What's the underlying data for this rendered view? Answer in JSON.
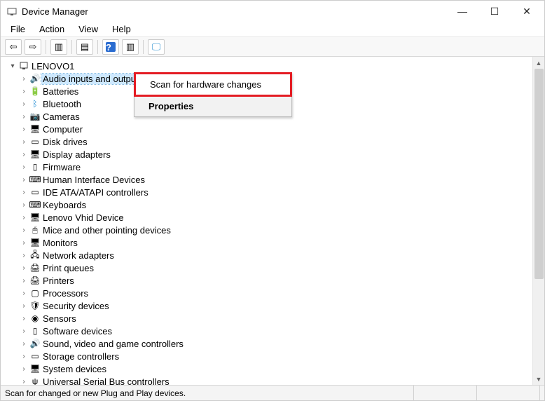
{
  "window": {
    "title": "Device Manager"
  },
  "menubar": {
    "items": [
      "File",
      "Action",
      "View",
      "Help"
    ]
  },
  "toolbar": {
    "back": "←",
    "forward": "→",
    "show_hide_console_tree": "▣",
    "properties": "▦",
    "help": "?",
    "refresh": "⟳",
    "scan": "🖵"
  },
  "tree": {
    "root_label": "LENOVO1",
    "categories": [
      {
        "label": "Audio inputs and outputs",
        "icon": "🔊",
        "selected": true
      },
      {
        "label": "Batteries",
        "icon": "🔋"
      },
      {
        "label": "Bluetooth",
        "icon": "ᛒ",
        "color": "#1084d0"
      },
      {
        "label": "Cameras",
        "icon": "📷"
      },
      {
        "label": "Computer",
        "icon": "🖥"
      },
      {
        "label": "Disk drives",
        "icon": "▭"
      },
      {
        "label": "Display adapters",
        "icon": "🖥"
      },
      {
        "label": "Firmware",
        "icon": "▯"
      },
      {
        "label": "Human Interface Devices",
        "icon": "⌨"
      },
      {
        "label": "IDE ATA/ATAPI controllers",
        "icon": "▭"
      },
      {
        "label": "Keyboards",
        "icon": "⌨"
      },
      {
        "label": "Lenovo Vhid Device",
        "icon": "🖥"
      },
      {
        "label": "Mice and other pointing devices",
        "icon": "🖱"
      },
      {
        "label": "Monitors",
        "icon": "🖥"
      },
      {
        "label": "Network adapters",
        "icon": "🖧"
      },
      {
        "label": "Print queues",
        "icon": "🖨"
      },
      {
        "label": "Printers",
        "icon": "🖨"
      },
      {
        "label": "Processors",
        "icon": "▢"
      },
      {
        "label": "Security devices",
        "icon": "🛡"
      },
      {
        "label": "Sensors",
        "icon": "◉"
      },
      {
        "label": "Software devices",
        "icon": "▯"
      },
      {
        "label": "Sound, video and game controllers",
        "icon": "🔊"
      },
      {
        "label": "Storage controllers",
        "icon": "▭"
      },
      {
        "label": "System devices",
        "icon": "🖥"
      },
      {
        "label": "Universal Serial Bus controllers",
        "icon": "ψ"
      }
    ]
  },
  "context_menu": {
    "items": [
      {
        "label": "Scan for hardware changes",
        "highlighted": true
      },
      {
        "label": "Properties",
        "bold": true
      }
    ]
  },
  "statusbar": {
    "text": "Scan for changed or new Plug and Play devices."
  }
}
